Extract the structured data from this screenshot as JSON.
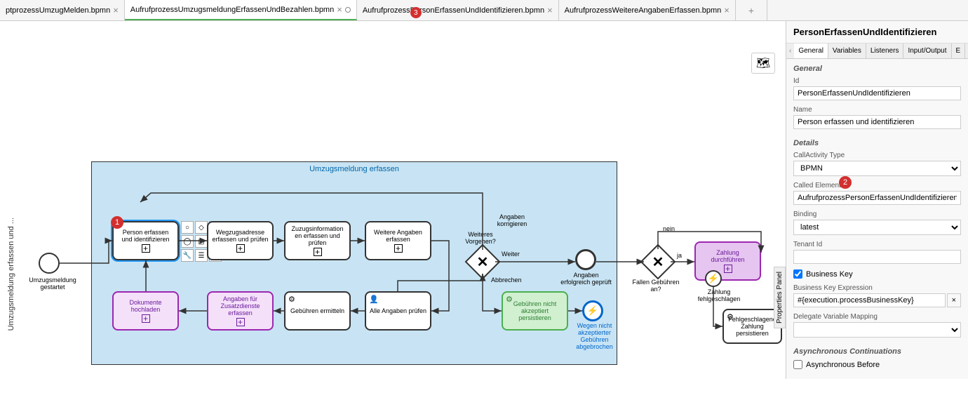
{
  "tabs": [
    {
      "label": "ptprozessUmzugMelden.bpmn"
    },
    {
      "label": "AufrufprozessUmzugsmeldungErfassenUndBezahlen.bpmn",
      "active": true,
      "dirty": true
    },
    {
      "label": "AufrufprozessPersonErfassenUndIdentifizieren.bpmn",
      "badge": "3"
    },
    {
      "label": "AufrufprozessWeitereAngabenErfassen.bpmn"
    }
  ],
  "vert_label": "Umzugsmeldung erfassen und ...",
  "start_label": "Umzugsmeldung gestartet",
  "pool_title": "Umzugsmeldung erfassen",
  "tasks": {
    "t1": "Person erfassen und identifizieren",
    "t2": "Wegzugsadresse erfassen und prüfen",
    "t3": "Zuzugsinformation en erfassen und prüfen",
    "t4": "Weitere Angaben erfassen",
    "t5": "Dokumente hochladen",
    "t6": "Angaben für Zusatzdienste erfassen",
    "t7": "Gebühren ermitteln",
    "t8": "Alle Angaben prüfen",
    "t9": "Gebühren nicht akzeptiert persistieren",
    "t10": "Zahlung durchführen",
    "t11": "Fehlgeschlagene Zahlung persistieren"
  },
  "labels": {
    "gw1": "Weiteres Vorgehen?",
    "korr": "Angaben korrigieren",
    "weiter": "Weiter",
    "abbr": "Abbrechen",
    "end1": "Angaben erfolgreich geprüft",
    "end2": "Wegen nicht akzeptierter Gebühren abgebrochen",
    "gw2": "Fallen Gebühren an?",
    "ja": "ja",
    "nein": "nein",
    "zfehl": "Zahlung fehlgeschlagen"
  },
  "annotations": {
    "a1": "1",
    "a2": "2",
    "a3": "3"
  },
  "props": {
    "title": "PersonErfassenUndIdentifizieren",
    "tabs": {
      "general": "General",
      "variables": "Variables",
      "listeners": "Listeners",
      "io": "Input/Output",
      "ext": "E"
    },
    "section_general": "General",
    "id_label": "Id",
    "id_value": "PersonErfassenUndIdentifizieren",
    "name_label": "Name",
    "name_value": "Person erfassen und identifizieren",
    "section_details": "Details",
    "ca_type_label": "CallActivity Type",
    "ca_type_value": "BPMN",
    "called_label": "Called Element",
    "called_value": "AufrufprozessPersonErfassenUndIdentifizieren",
    "binding_label": "Binding",
    "binding_value": "latest",
    "tenant_label": "Tenant Id",
    "tenant_value": "",
    "bk_label": "Business Key",
    "bke_label": "Business Key Expression",
    "bke_value": "#{execution.processBusinessKey}",
    "dvm_label": "Delegate Variable Mapping",
    "dvm_value": "",
    "section_async": "Asynchronous Continuations",
    "async_before": "Asynchronous Before"
  },
  "props_toggle": "Properties Panel"
}
